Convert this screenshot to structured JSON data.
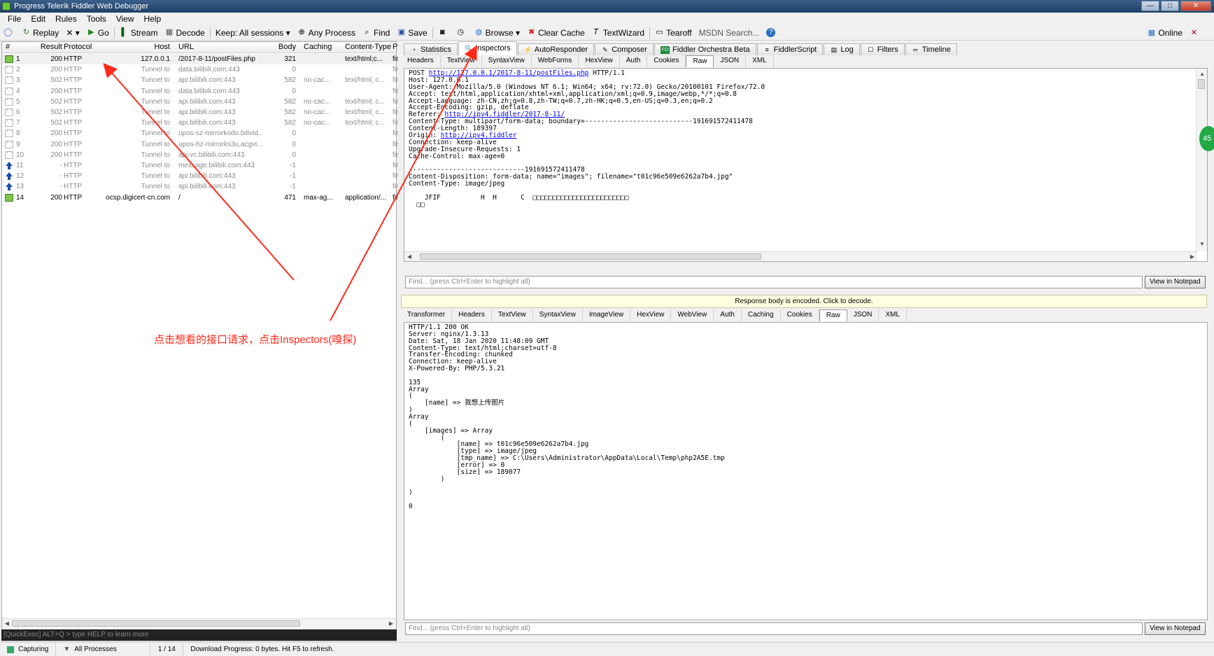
{
  "window": {
    "title": "Progress Telerik Fiddler Web Debugger",
    "controls": [
      "—",
      "□",
      "✕"
    ]
  },
  "menu": [
    {
      "label": "File",
      "name": "menu-file"
    },
    {
      "label": "Edit",
      "name": "menu-edit"
    },
    {
      "label": "Rules",
      "name": "menu-rules"
    },
    {
      "label": "Tools",
      "name": "menu-tools"
    },
    {
      "label": "View",
      "name": "menu-view"
    },
    {
      "label": "Help",
      "name": "menu-help"
    }
  ],
  "toolbar": {
    "replay": "Replay",
    "remove": "✕ ▾",
    "go": "Go",
    "stream": "Stream",
    "decode": "Decode",
    "keep": "Keep: All sessions ▾",
    "any_process": "Any Process",
    "find": "Find",
    "save": "Save",
    "browse": "Browse ▾",
    "clear_cache": "Clear Cache",
    "textwizard": "TextWizard",
    "tearoff": "Tearoff",
    "msdn_search": "MSDN Search...",
    "online": "Online"
  },
  "sessions": {
    "columns": [
      "#",
      "Result",
      "Protocol",
      "Host",
      "URL",
      "Body",
      "Caching",
      "Content-Type",
      "Pr"
    ],
    "rows": [
      {
        "id": "1",
        "result": "200",
        "protocol": "HTTP",
        "host": "127.0.0.1",
        "url": "/2017-8-11/postFiles.php",
        "body": "321",
        "caching": "",
        "ctype": "text/html;c...",
        "pr": "fir",
        "icon": "go",
        "style": "sel"
      },
      {
        "id": "2",
        "result": "200",
        "protocol": "HTTP",
        "host": "Tunnel to",
        "url": "data.bilibili.com:443",
        "body": "0",
        "caching": "",
        "ctype": "",
        "pr": "fir",
        "icon": "lock",
        "style": ""
      },
      {
        "id": "3",
        "result": "502",
        "protocol": "HTTP",
        "host": "Tunnel to",
        "url": "api.bilibili.com:443",
        "body": "582",
        "caching": "no-cac...",
        "ctype": "text/html; c...",
        "pr": "fir",
        "icon": "lock",
        "style": ""
      },
      {
        "id": "4",
        "result": "200",
        "protocol": "HTTP",
        "host": "Tunnel to",
        "url": "data.bilibili.com:443",
        "body": "0",
        "caching": "",
        "ctype": "",
        "pr": "fir",
        "icon": "lock",
        "style": ""
      },
      {
        "id": "5",
        "result": "502",
        "protocol": "HTTP",
        "host": "Tunnel to",
        "url": "api.bilibili.com:443",
        "body": "582",
        "caching": "no-cac...",
        "ctype": "text/html; c...",
        "pr": "fir",
        "icon": "lock",
        "style": ""
      },
      {
        "id": "6",
        "result": "502",
        "protocol": "HTTP",
        "host": "Tunnel to",
        "url": "api.bilibili.com:443",
        "body": "582",
        "caching": "no-cac...",
        "ctype": "text/html; c...",
        "pr": "fir",
        "icon": "lock",
        "style": ""
      },
      {
        "id": "7",
        "result": "502",
        "protocol": "HTTP",
        "host": "Tunnel to",
        "url": "api.bilibili.com:443",
        "body": "582",
        "caching": "no-cac...",
        "ctype": "text/html; c...",
        "pr": "fir",
        "icon": "lock",
        "style": ""
      },
      {
        "id": "8",
        "result": "200",
        "protocol": "HTTP",
        "host": "Tunnel to",
        "url": "upos-sz-mirrorkodo.bilivid...",
        "body": "0",
        "caching": "",
        "ctype": "",
        "pr": "fir",
        "icon": "lock",
        "style": ""
      },
      {
        "id": "9",
        "result": "200",
        "protocol": "HTTP",
        "host": "Tunnel to",
        "url": "upos-hz-mirrorks3u.acgvi...",
        "body": "0",
        "caching": "",
        "ctype": "",
        "pr": "fir",
        "icon": "lock",
        "style": ""
      },
      {
        "id": "10",
        "result": "200",
        "protocol": "HTTP",
        "host": "Tunnel to",
        "url": "api.vc.bilibili.com:443",
        "body": "0",
        "caching": "",
        "ctype": "",
        "pr": "fir",
        "icon": "lock",
        "style": ""
      },
      {
        "id": "11",
        "result": "-",
        "protocol": "HTTP",
        "host": "Tunnel to",
        "url": "message.bilibili.com:443",
        "body": "-1",
        "caching": "",
        "ctype": "",
        "pr": "fir",
        "icon": "up",
        "style": ""
      },
      {
        "id": "12",
        "result": "-",
        "protocol": "HTTP",
        "host": "Tunnel to",
        "url": "api.bilibili.com:443",
        "body": "-1",
        "caching": "",
        "ctype": "",
        "pr": "fir",
        "icon": "up",
        "style": ""
      },
      {
        "id": "13",
        "result": "-",
        "protocol": "HTTP",
        "host": "Tunnel to",
        "url": "api.bilibili.com:443",
        "body": "-1",
        "caching": "",
        "ctype": "",
        "pr": "fir",
        "icon": "up",
        "style": ""
      },
      {
        "id": "14",
        "result": "200",
        "protocol": "HTTP",
        "host": "ocsp.digicert-cn.com",
        "url": "/",
        "body": "471",
        "caching": "max-ag...",
        "ctype": "application/...",
        "pr": "fir",
        "icon": "go",
        "style": "dark"
      }
    ]
  },
  "quickexec": {
    "placeholder": "[QuickExec] ALT+Q > type HELP to learn more"
  },
  "status": {
    "capturing": "Capturing",
    "processes": "All Processes",
    "count": "1 / 14",
    "progress": "Download Progress: 0 bytes. Hit F5 to refresh."
  },
  "main_tabs": [
    {
      "label": "Statistics",
      "name": "tab-statistics",
      "icon": "◔",
      "active": false
    },
    {
      "label": "Inspectors",
      "name": "tab-inspectors",
      "icon": "🔍",
      "active": true
    },
    {
      "label": "AutoResponder",
      "name": "tab-autoresponder",
      "icon": "⚡",
      "active": false
    },
    {
      "label": "Composer",
      "name": "tab-composer",
      "icon": "✎",
      "active": false
    },
    {
      "label": "Fiddler Orchestra Beta",
      "name": "tab-orchestra",
      "icon": "FO",
      "active": false
    },
    {
      "label": "FiddlerScript",
      "name": "tab-fiddlerscript",
      "icon": "≡",
      "active": false
    },
    {
      "label": "Log",
      "name": "tab-log",
      "icon": "▤",
      "active": false
    },
    {
      "label": "Filters",
      "name": "tab-filters",
      "icon": "☐",
      "active": false
    },
    {
      "label": "Timeline",
      "name": "tab-timeline",
      "icon": "═",
      "active": false
    }
  ],
  "request": {
    "tabs": [
      {
        "label": "Headers",
        "active": false
      },
      {
        "label": "TextView",
        "active": false
      },
      {
        "label": "SyntaxView",
        "active": false
      },
      {
        "label": "WebForms",
        "active": false
      },
      {
        "label": "HexView",
        "active": false
      },
      {
        "label": "Auth",
        "active": false
      },
      {
        "label": "Cookies",
        "active": false
      },
      {
        "label": "Raw",
        "active": true
      },
      {
        "label": "JSON",
        "active": false
      },
      {
        "label": "XML",
        "active": false
      }
    ],
    "lines": [
      {
        "pre": "POST ",
        "link": "http://127.0.0.1/2017-8-11/postFiles.php",
        "post": " HTTP/1.1"
      },
      {
        "pre": "Host: 127.0.0.1"
      },
      {
        "pre": "User-Agent: Mozilla/5.0 (Windows NT 6.1; Win64; x64; rv:72.0) Gecko/20100101 Firefox/72.0"
      },
      {
        "pre": "Accept: text/html,application/xhtml+xml,application/xml;q=0.9,image/webp,*/*;q=0.8"
      },
      {
        "pre": "Accept-Language: zh-CN,zh;q=0.8,zh-TW;q=0.7,zh-HK;q=0.5,en-US;q=0.3,en;q=0.2"
      },
      {
        "pre": "Accept-Encoding: gzip, deflate"
      },
      {
        "pre": "Referer: ",
        "link": "http://ipv4.fiddler/2017-8-11/"
      },
      {
        "pre": "Content-Type: multipart/form-data; boundary=---------------------------191691572411478"
      },
      {
        "pre": "Content-Length: 189397"
      },
      {
        "pre": "Origin: ",
        "link": "http://ipv4.fiddler"
      },
      {
        "pre": "Connection: keep-alive"
      },
      {
        "pre": "Upgrade-Insecure-Requests: 1"
      },
      {
        "pre": "Cache-Control: max-age=0"
      },
      {
        "pre": ""
      },
      {
        "pre": "-----------------------------191691572411478"
      },
      {
        "pre": "Content-Disposition: form-data; name=\"images\"; filename=\"t01c96e509e6262a7b4.jpg\""
      },
      {
        "pre": "Content-Type: image/jpeg"
      },
      {
        "pre": ""
      },
      {
        "pre": "    JFIF          H  H      C  □□□□□□□□□□□□□□□□□□□□□□□□"
      },
      {
        "pre": "  □□"
      }
    ],
    "find_placeholder": "Find... (press Ctrl+Enter to highlight all)",
    "notepad_label": "View in Notepad"
  },
  "encoded_notice": "Response body is encoded. Click to decode.",
  "response": {
    "tabs": [
      {
        "label": "Transformer",
        "active": false
      },
      {
        "label": "Headers",
        "active": false
      },
      {
        "label": "TextView",
        "active": false
      },
      {
        "label": "SyntaxView",
        "active": false
      },
      {
        "label": "ImageView",
        "active": false
      },
      {
        "label": "HexView",
        "active": false
      },
      {
        "label": "WebView",
        "active": false
      },
      {
        "label": "Auth",
        "active": false
      },
      {
        "label": "Caching",
        "active": false
      },
      {
        "label": "Cookies",
        "active": false
      },
      {
        "label": "Raw",
        "active": true
      },
      {
        "label": "JSON",
        "active": false
      },
      {
        "label": "XML",
        "active": false
      }
    ],
    "lines": [
      {
        "pre": "HTTP/1.1 200 OK"
      },
      {
        "pre": "Server: nginx/1.3.13"
      },
      {
        "pre": "Date: Sat, 18 Jan 2020 11:48:09 GMT"
      },
      {
        "pre": "Content-Type: text/html;charset=utf-8"
      },
      {
        "pre": "Transfer-Encoding: chunked"
      },
      {
        "pre": "Connection: keep-alive"
      },
      {
        "pre": "X-Powered-By: PHP/5.3.21"
      },
      {
        "pre": ""
      },
      {
        "pre": "135"
      },
      {
        "pre": "Array"
      },
      {
        "pre": "("
      },
      {
        "pre": "    [name] => 我想上传图片"
      },
      {
        "pre": ")"
      },
      {
        "pre": "Array"
      },
      {
        "pre": "("
      },
      {
        "pre": "    [images] => Array"
      },
      {
        "pre": "        ("
      },
      {
        "pre": "            [name] => t01c96e509e6262a7b4.jpg"
      },
      {
        "pre": "            [type] => image/jpeg"
      },
      {
        "pre": "            [tmp_name] => C:\\Users\\Administrator\\AppData\\Local\\Temp\\php2A5E.tmp"
      },
      {
        "pre": "            [error] => 0"
      },
      {
        "pre": "            [size] => 189077"
      },
      {
        "pre": "        )"
      },
      {
        "pre": ""
      },
      {
        "pre": ")"
      },
      {
        "pre": ""
      },
      {
        "pre": "0"
      }
    ],
    "find_placeholder": "Find... (press Ctrl+Enter to highlight all)",
    "notepad_label": "View in Notepad"
  },
  "annotation": {
    "text": "点击想看的接口请求，点击Inspectors(嗅探)",
    "color": "#ff2a1a"
  },
  "green_bubble": "45"
}
